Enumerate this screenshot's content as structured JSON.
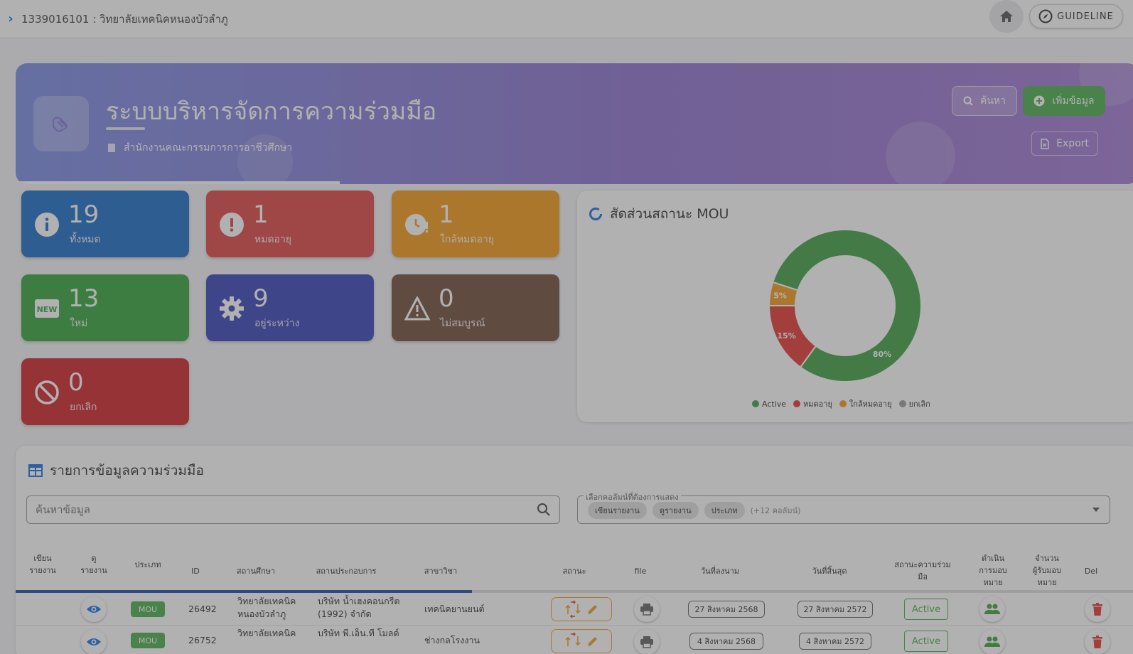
{
  "topbar": {
    "breadcrumb": "1339016101 : วิทยาลัยเทคนิคหนองบัวลำภู",
    "guideline_label": "GUIDELINE"
  },
  "hero": {
    "title": "ระบบบริหารจัดการความร่วมมือ",
    "subtitle": "สำนักงานคณะกรรมการการอาชีวศึกษา",
    "search_label": "ค้นหา",
    "add_label": "เพิ่มข้อมูล",
    "export_label": "Export"
  },
  "stats": [
    {
      "value": "19",
      "label": "ทั้งหมด",
      "color": "#1e6ec8"
    },
    {
      "value": "1",
      "label": "หมดอายุ",
      "color": "#e04848"
    },
    {
      "value": "1",
      "label": "ใกล้หมดอายุ",
      "color": "#f59c1a"
    },
    {
      "value": "13",
      "label": "ใหม่",
      "color": "#3aa640"
    },
    {
      "value": "9",
      "label": "อยู่ระหว่าง",
      "color": "#3a45b8"
    },
    {
      "value": "0",
      "label": "ไม่สมบูรณ์",
      "color": "#74503f"
    },
    {
      "value": "0",
      "label": "ยกเลิก",
      "color": "#d0262c"
    }
  ],
  "chart": {
    "title": "สัดส่วนสถานะ MOU",
    "legend": [
      {
        "name": "Active",
        "color": "#43a047"
      },
      {
        "name": "หมดอายุ",
        "color": "#e53935"
      },
      {
        "name": "ใกล้หมดอายุ",
        "color": "#f59c1a"
      },
      {
        "name": "ยกเลิก",
        "color": "#9e9e9e"
      }
    ]
  },
  "chart_data": {
    "type": "pie",
    "title": "สัดส่วนสถานะ MOU",
    "categories": [
      "Active",
      "หมดอายุ",
      "ใกล้หมดอายุ",
      "ยกเลิก"
    ],
    "values": [
      80,
      15,
      5,
      0
    ],
    "data_labels": [
      "80%",
      "15%",
      "5%",
      ""
    ],
    "colors": [
      "#43a047",
      "#e53935",
      "#f59c1a",
      "#9e9e9e"
    ],
    "legend_position": "bottom"
  },
  "table": {
    "title": "รายการข้อมูลความร่วมมือ",
    "search_placeholder": "ค้นหาข้อมูล",
    "column_select_label": "เลือกคอลัมน์ที่ต้องการแสดง",
    "chips": [
      "เขียนรายงาน",
      "ดูรายงาน",
      "ประเภท"
    ],
    "chips_more": "(+12 คอลัมน์)",
    "headers": {
      "write_report": "เขียน\nรายงาน",
      "view_report": "ดู\nรายงาน",
      "type": "ประเภท",
      "id": "ID",
      "school": "สถานศึกษา",
      "company": "สถานประกอบการ",
      "major": "สาขาวิชา",
      "status": "สถานะ",
      "file": "file",
      "sign_date": "วันที่ลงนาม",
      "end_date": "วันที่สิ้นสุด",
      "coop_status": "สถานะความร่วม\nมือ",
      "assign": "ดำเนิน\nการมอบ\nหมาย",
      "assignee_count": "จำนวน\nผู้รับมอบ\nหมาย",
      "del": "Del"
    },
    "rows": [
      {
        "type": "MOU",
        "id": "26492",
        "school": "วิทยาลัยเทคนิค\nหนองบัวลำภู",
        "company": "บริษัท น้ำเฮงคอนกรีต\n(1992) จำกัด",
        "major": "เทคนิคยานยนต์",
        "sign_date": "27 สิงหาคม 2568",
        "end_date": "27 สิงหาคม 2572",
        "coop_status": "Active"
      },
      {
        "type": "MOU",
        "id": "26752",
        "school": "วิทยาลัยเทคนิค",
        "company": "บริษัท พี.เอ็น.ที โมลด์",
        "major": "ช่างกลโรงงาน",
        "sign_date": "4 สิงหาคม 2568",
        "end_date": "4 สิงหาคม 2572",
        "coop_status": "Active"
      }
    ]
  }
}
